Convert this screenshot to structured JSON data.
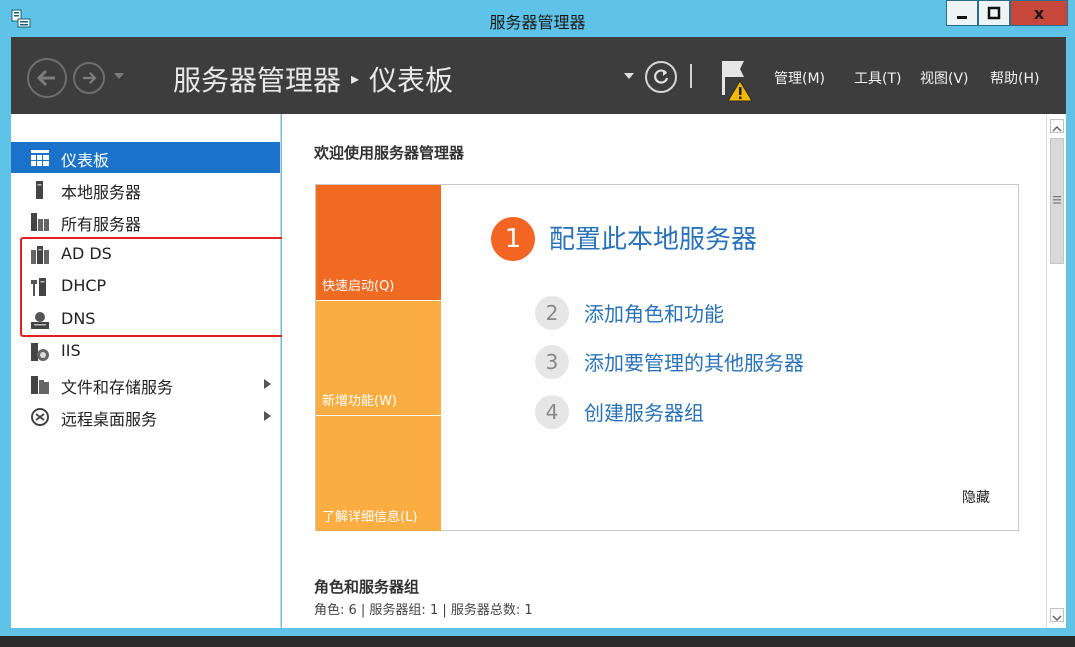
{
  "window": {
    "title": "服务器管理器",
    "close_glyph": "x"
  },
  "header": {
    "breadcrumb_app": "服务器管理器",
    "breadcrumb_separator": "▸",
    "breadcrumb_page": "仪表板",
    "menus": [
      "管理(M)",
      "工具(T)",
      "视图(V)",
      "帮助(H)"
    ]
  },
  "sidebar": {
    "items": [
      {
        "label": "仪表板",
        "icon": "dashboard-icon",
        "active": true
      },
      {
        "label": "本地服务器",
        "icon": "server-icon"
      },
      {
        "label": "所有服务器",
        "icon": "servers-icon"
      },
      {
        "label": "AD DS",
        "icon": "ad-ds-icon"
      },
      {
        "label": "DHCP",
        "icon": "dhcp-icon"
      },
      {
        "label": "DNS",
        "icon": "dns-icon"
      },
      {
        "label": "IIS",
        "icon": "iis-icon"
      },
      {
        "label": "文件和存储服务",
        "icon": "file-storage-icon",
        "expandable": true
      },
      {
        "label": "远程桌面服务",
        "icon": "remote-desktop-icon",
        "expandable": true
      }
    ]
  },
  "main": {
    "welcome_heading": "欢迎使用服务器管理器",
    "tiles": [
      "快速启动(Q)",
      "新增功能(W)",
      "了解详细信息(L)"
    ],
    "steps": [
      {
        "number": "1",
        "label": "配置此本地服务器"
      },
      {
        "number": "2",
        "label": "添加角色和功能"
      },
      {
        "number": "3",
        "label": "添加要管理的其他服务器"
      },
      {
        "number": "4",
        "label": "创建服务器组"
      }
    ],
    "hide_label": "隐藏",
    "roles_heading": "角色和服务器组",
    "roles_summary": "角色: 6 | 服务器组: 1 | 服务器总数: 1"
  },
  "colors": {
    "titlebar": "#5ec3e6",
    "header_bg": "#3d3d3d",
    "sidebar_active": "#1a73c8",
    "tile_quick": "#f16a22",
    "tile_other": "#fbad42",
    "link_blue": "#2a73b9",
    "highlight_red": "#e0201c"
  }
}
